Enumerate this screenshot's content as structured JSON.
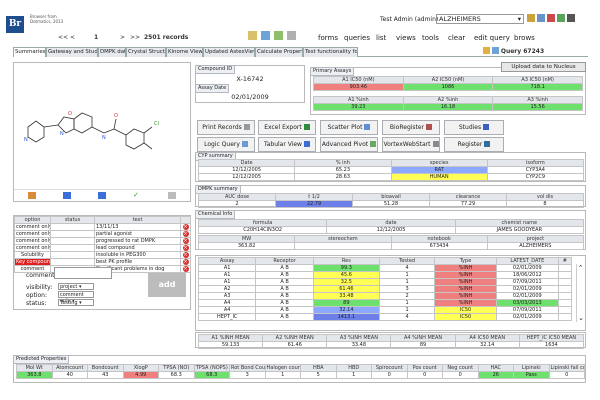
{
  "header": {
    "logo": "Br",
    "app_title": "Browser from",
    "app_subtitle": "Dotmatics, 2013",
    "nav_first": "<<",
    "nav_prev": "<",
    "page": "1",
    "nav_next": ">",
    "nav_last": ">>",
    "records": "2501 records",
    "user": "Test Admin (admin)",
    "project": "ALZHEIMERS"
  },
  "menu": [
    "forms",
    "queries",
    "list",
    "views",
    "tools",
    "clear",
    "edit query",
    "brows"
  ],
  "query_label": "Query 67243",
  "tabs": [
    "Summaries",
    "Gateway and Studies Info",
    "DMPK data",
    "Crystal Structures",
    "Kinome Viewer",
    "Updated AstexViewer",
    "Calculate Properties",
    "Test functionality form"
  ],
  "compound": {
    "id_label": "Compound ID",
    "id": "X-16742",
    "date_label": "Assay Date",
    "date": "02/01/2009"
  },
  "primary": {
    "label": "Primary Assays",
    "upload": "Upload data to Nucleus",
    "headers": [
      "A1 IC50 (nM)",
      "A2 IC50 (nM)",
      "A3 IC50 (nM)"
    ],
    "ic50": [
      "903.46",
      "1086",
      "718.1"
    ],
    "inh_headers": [
      "A1 %inh",
      "A2 %inh",
      "A3 %inh"
    ],
    "inh": [
      "39.23",
      "16.18",
      "15.56"
    ]
  },
  "buttons": [
    "Print Records",
    "Excel Export",
    "Scatter Plot",
    "BioRegister",
    "Studies",
    "Logic Query",
    "Tabular View",
    "Advanced Pivot",
    "VortexWebStart",
    "Register"
  ],
  "cyp": {
    "label": "CYP summary",
    "headers": [
      "Date",
      "% inh",
      "species",
      "isoform"
    ],
    "rows": [
      [
        "12/12/2005",
        "65.23",
        "RAT",
        "CYP3A4"
      ],
      [
        "12/12/2005",
        "28.63",
        "HUMAN",
        "CYP2C9"
      ]
    ]
  },
  "dmpk": {
    "label": "DMPK summary",
    "headers": [
      "AUC dose",
      "t 1/2",
      "bioavail",
      "clearance",
      "vol dis"
    ],
    "row": [
      "2",
      "22.79",
      "51.28",
      "77.29",
      "8"
    ]
  },
  "chem": {
    "label": "Chemical Info",
    "h1": [
      "formula",
      "date",
      "chemist name"
    ],
    "r1": [
      "C20H14ClN3O2",
      "12/12/2005",
      "JAMES GOODYEAR"
    ],
    "h2": [
      "MW",
      "stereochem",
      "notebook",
      "project"
    ],
    "r2": [
      "363.82",
      "",
      "673434",
      "ALZHEIMERS"
    ]
  },
  "assay": {
    "headers": [
      "Assay",
      "Receptor",
      "Res",
      "Tested",
      "Type",
      "LATEST_DATE",
      "#"
    ],
    "rows": [
      [
        "A1",
        "A B",
        "99.3",
        "4",
        "%INH",
        "02/01/2009"
      ],
      [
        "A1",
        "A B",
        "45.6",
        "1",
        "%INH",
        "18/06/2012"
      ],
      [
        "A1",
        "A B",
        "32.5",
        "1",
        "%INH",
        "07/09/2011"
      ],
      [
        "A2",
        "A B",
        "61.46",
        "3",
        "%INH",
        "02/01/2009"
      ],
      [
        "A3",
        "A B",
        "33.48",
        "2",
        "%INH",
        "02/01/2009"
      ],
      [
        "A4",
        "A B",
        "89",
        "1",
        "%INH",
        "03/03/2013"
      ],
      [
        "A4",
        "A B",
        "32.14",
        "1",
        "IC50",
        "07/09/2011"
      ],
      [
        "HEPT_IC",
        "A B",
        "1413.1",
        "4",
        "IC50",
        "02/01/2009"
      ]
    ],
    "mean_headers": [
      "A1 %INH MEAN",
      "A2 %INH MEAN",
      "A3 %INH MEAN",
      "A4 %INH MEAN",
      "A4 IC50 MEAN",
      "HEPT_IC IC50 MEAN"
    ],
    "means": [
      "59.133",
      "61.46",
      "33.48",
      "89",
      "32.14",
      "1634"
    ]
  },
  "comments": {
    "headers": [
      "option",
      "status",
      "text"
    ],
    "rows": [
      [
        "comment only",
        "",
        "13/11/13"
      ],
      [
        "comment only",
        "",
        "partial agonist"
      ],
      [
        "comment only",
        "",
        "progressed to rat DMPK"
      ],
      [
        "comment only",
        "",
        "lead compound"
      ],
      [
        "Solubility",
        "",
        "insoluble in PEG300"
      ],
      [
        "Key compound",
        "",
        "best PK profile"
      ],
      [
        "comment",
        "",
        "Significant problems in dog"
      ]
    ],
    "form_labels": [
      "comment:",
      "visibility:",
      "option:",
      "status:"
    ],
    "visibility": "project",
    "option": "comment only",
    "status": "Testing",
    "add": "add"
  },
  "predicted": {
    "label": "Predicted Properties",
    "headers": [
      "Mol Wt",
      "Atomcount",
      "Bondcount",
      "XlogP",
      "TPSA (NO)",
      "TPSA (NOPS)",
      "Rot Bond Count",
      "Halogen count",
      "HBA",
      "HBD",
      "Spirocount",
      "Pos count",
      "Neg count",
      "HAC",
      "Lipinski",
      "Lipinski fail count"
    ],
    "values": [
      "363.8",
      "40",
      "43",
      "4.99",
      "68.3",
      "68.3",
      "3",
      "1",
      "5",
      "1",
      "0",
      "0",
      "0",
      "26",
      "Pass",
      "0"
    ]
  },
  "colors": {
    "red": "#f08080",
    "green": "#6ee06e",
    "yellow": "#ffff55",
    "blue": "#8da9ff"
  }
}
